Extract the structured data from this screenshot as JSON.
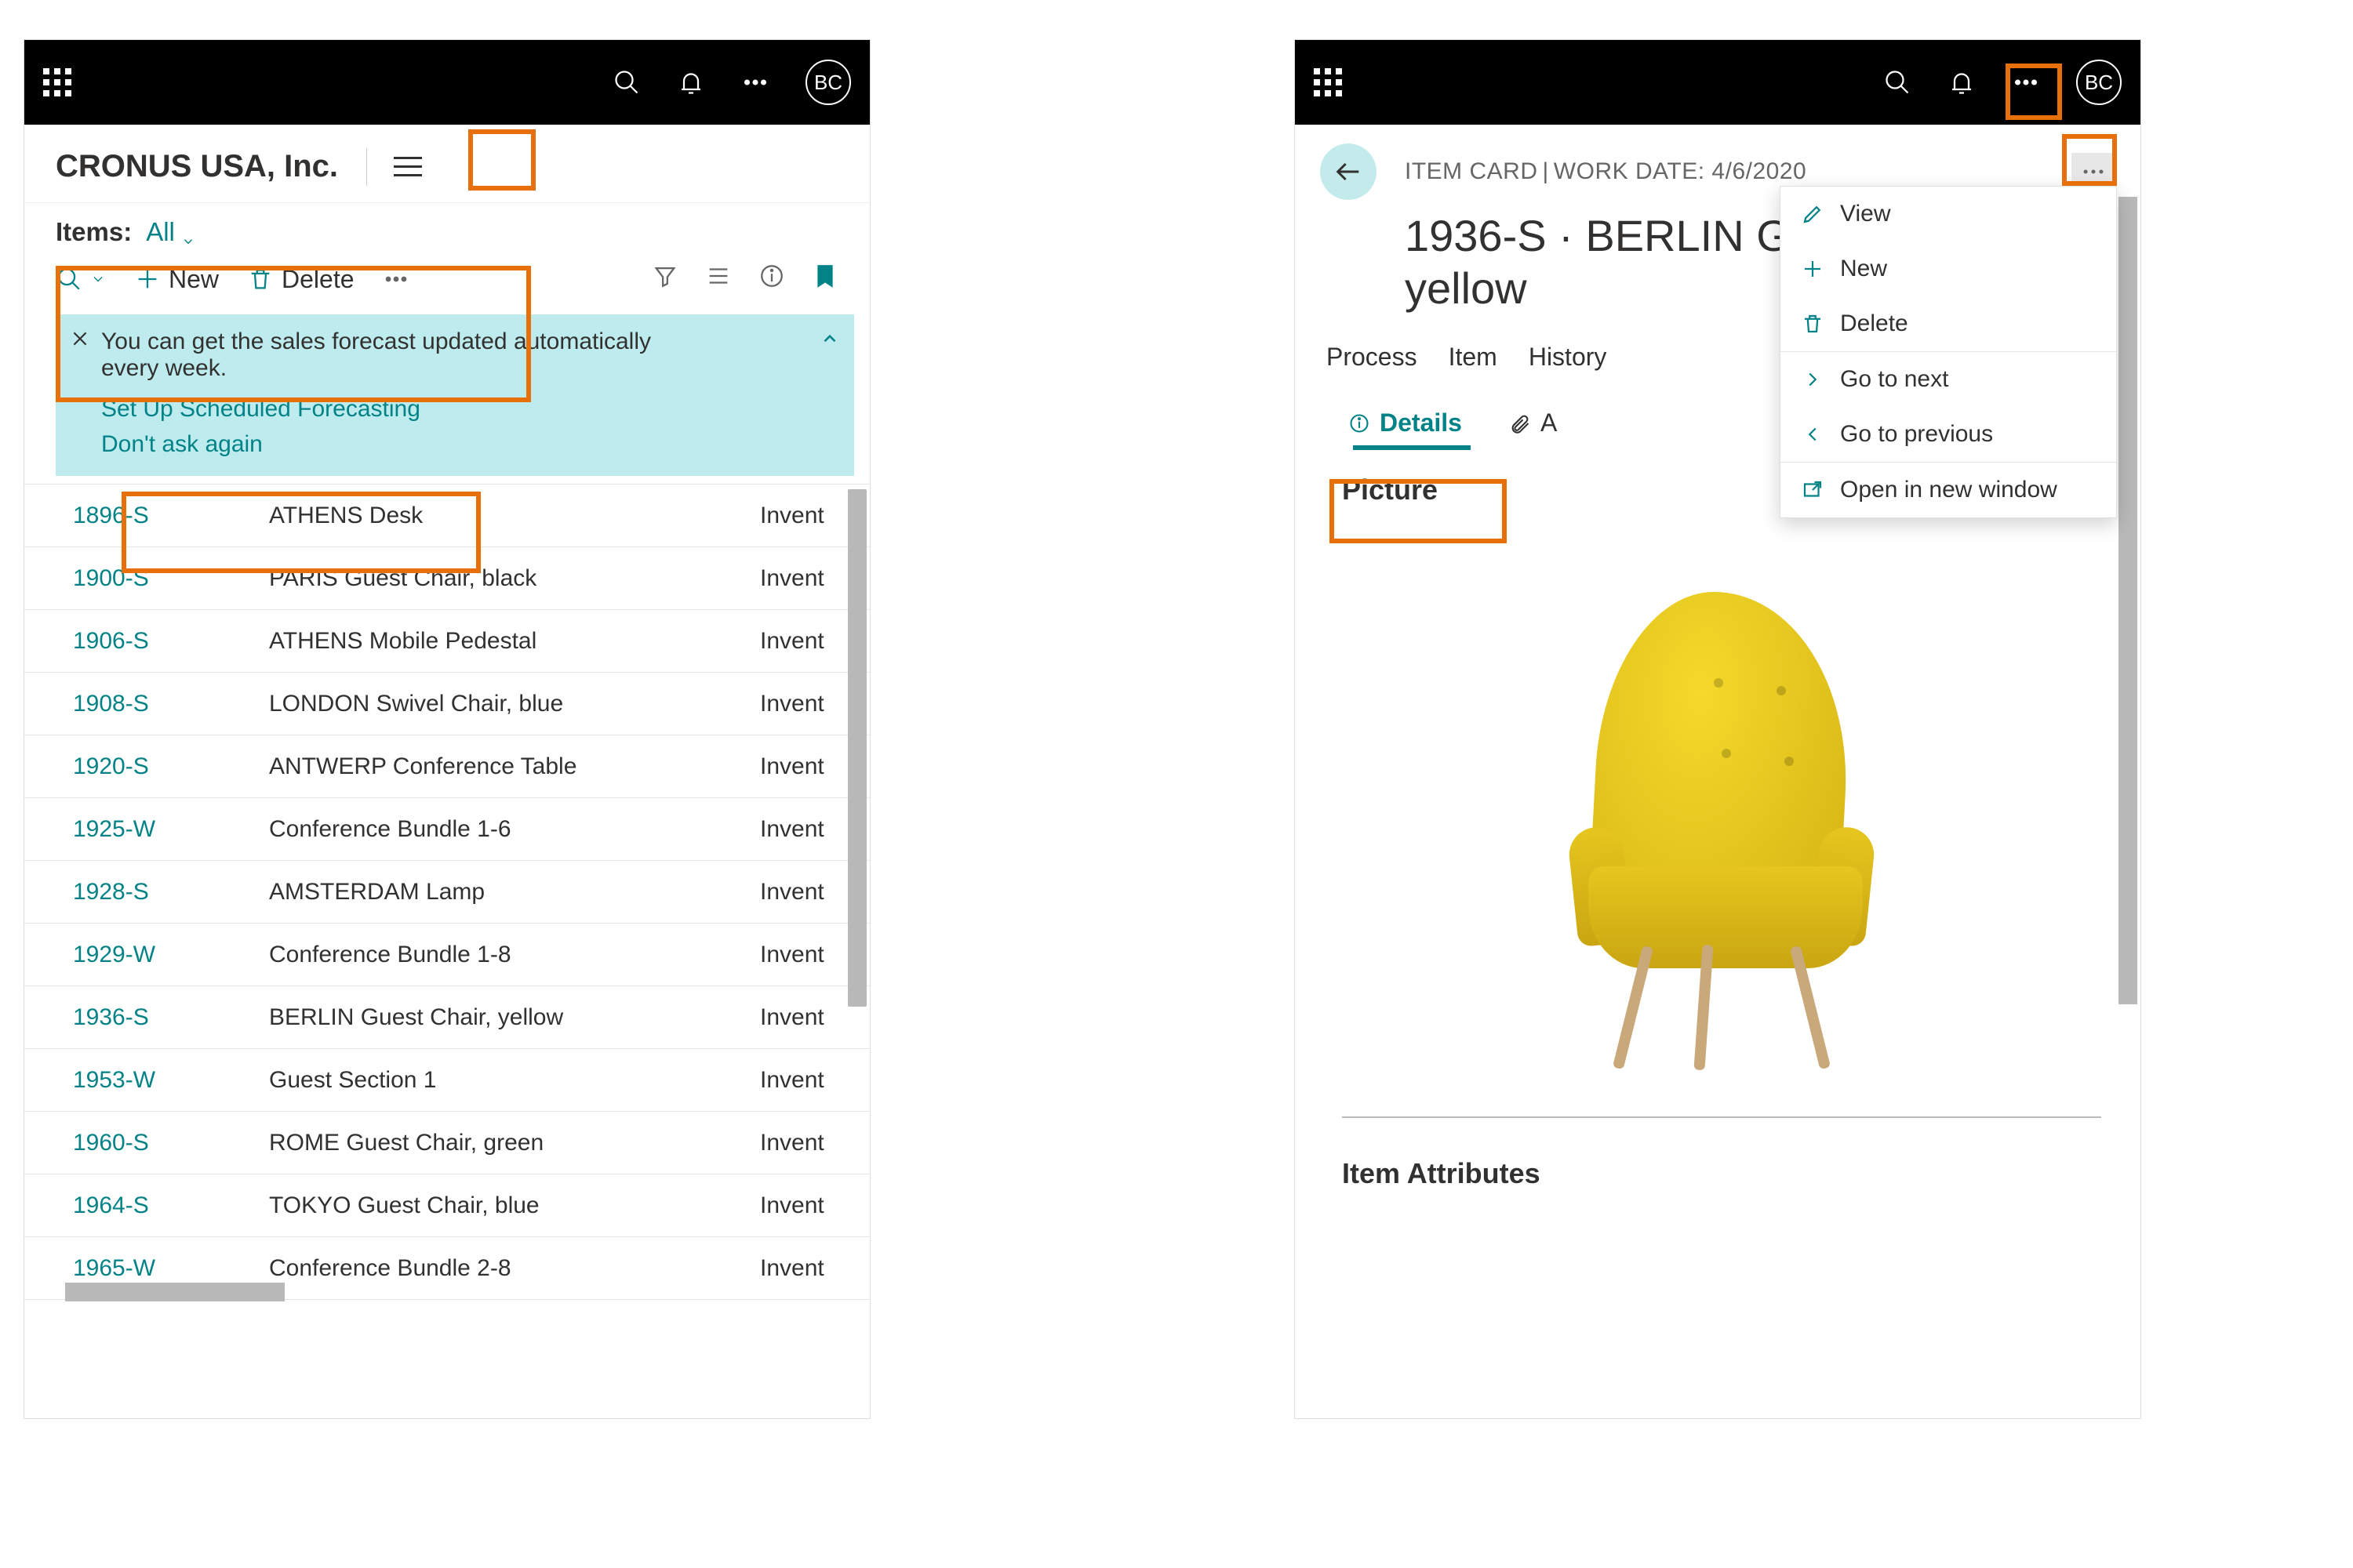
{
  "user_initials": "BC",
  "left": {
    "company": "CRONUS USA, Inc.",
    "items_label": "Items:",
    "filter": "All",
    "toolbar": {
      "new": "New",
      "delete": "Delete"
    },
    "banner": {
      "text": "You can get the sales forecast updated automatically every week.",
      "link1": "Set Up Scheduled Forecasting",
      "link2": "Don't ask again"
    },
    "col3": "Invent",
    "rows": [
      {
        "no": "1896-S",
        "desc": "ATHENS Desk"
      },
      {
        "no": "1900-S",
        "desc": "PARIS Guest Chair, black"
      },
      {
        "no": "1906-S",
        "desc": "ATHENS Mobile Pedestal"
      },
      {
        "no": "1908-S",
        "desc": "LONDON Swivel Chair, blue"
      },
      {
        "no": "1920-S",
        "desc": "ANTWERP Conference Table"
      },
      {
        "no": "1925-W",
        "desc": "Conference Bundle 1-6"
      },
      {
        "no": "1928-S",
        "desc": "AMSTERDAM Lamp"
      },
      {
        "no": "1929-W",
        "desc": "Conference Bundle 1-8"
      },
      {
        "no": "1936-S",
        "desc": "BERLIN Guest Chair, yellow"
      },
      {
        "no": "1953-W",
        "desc": "Guest Section 1"
      },
      {
        "no": "1960-S",
        "desc": "ROME Guest Chair, green"
      },
      {
        "no": "1964-S",
        "desc": "TOKYO Guest Chair, blue"
      },
      {
        "no": "1965-W",
        "desc": "Conference Bundle 2-8"
      }
    ]
  },
  "right": {
    "breadcrumb_card": "ITEM CARD",
    "breadcrumb_workdate_label": "WORK DATE:",
    "breadcrumb_workdate": "4/6/2020",
    "title_line": "1936-S · BERLIN Guest Chair, yellow",
    "tabs": [
      "Process",
      "Item",
      "History"
    ],
    "subtabs": {
      "details": "Details",
      "attachments_initial": "A"
    },
    "picture_label": "Picture",
    "attributes_label": "Item Attributes",
    "menu": {
      "view": "View",
      "new": "New",
      "delete": "Delete",
      "next": "Go to next",
      "prev": "Go to previous",
      "open": "Open in new window"
    }
  }
}
